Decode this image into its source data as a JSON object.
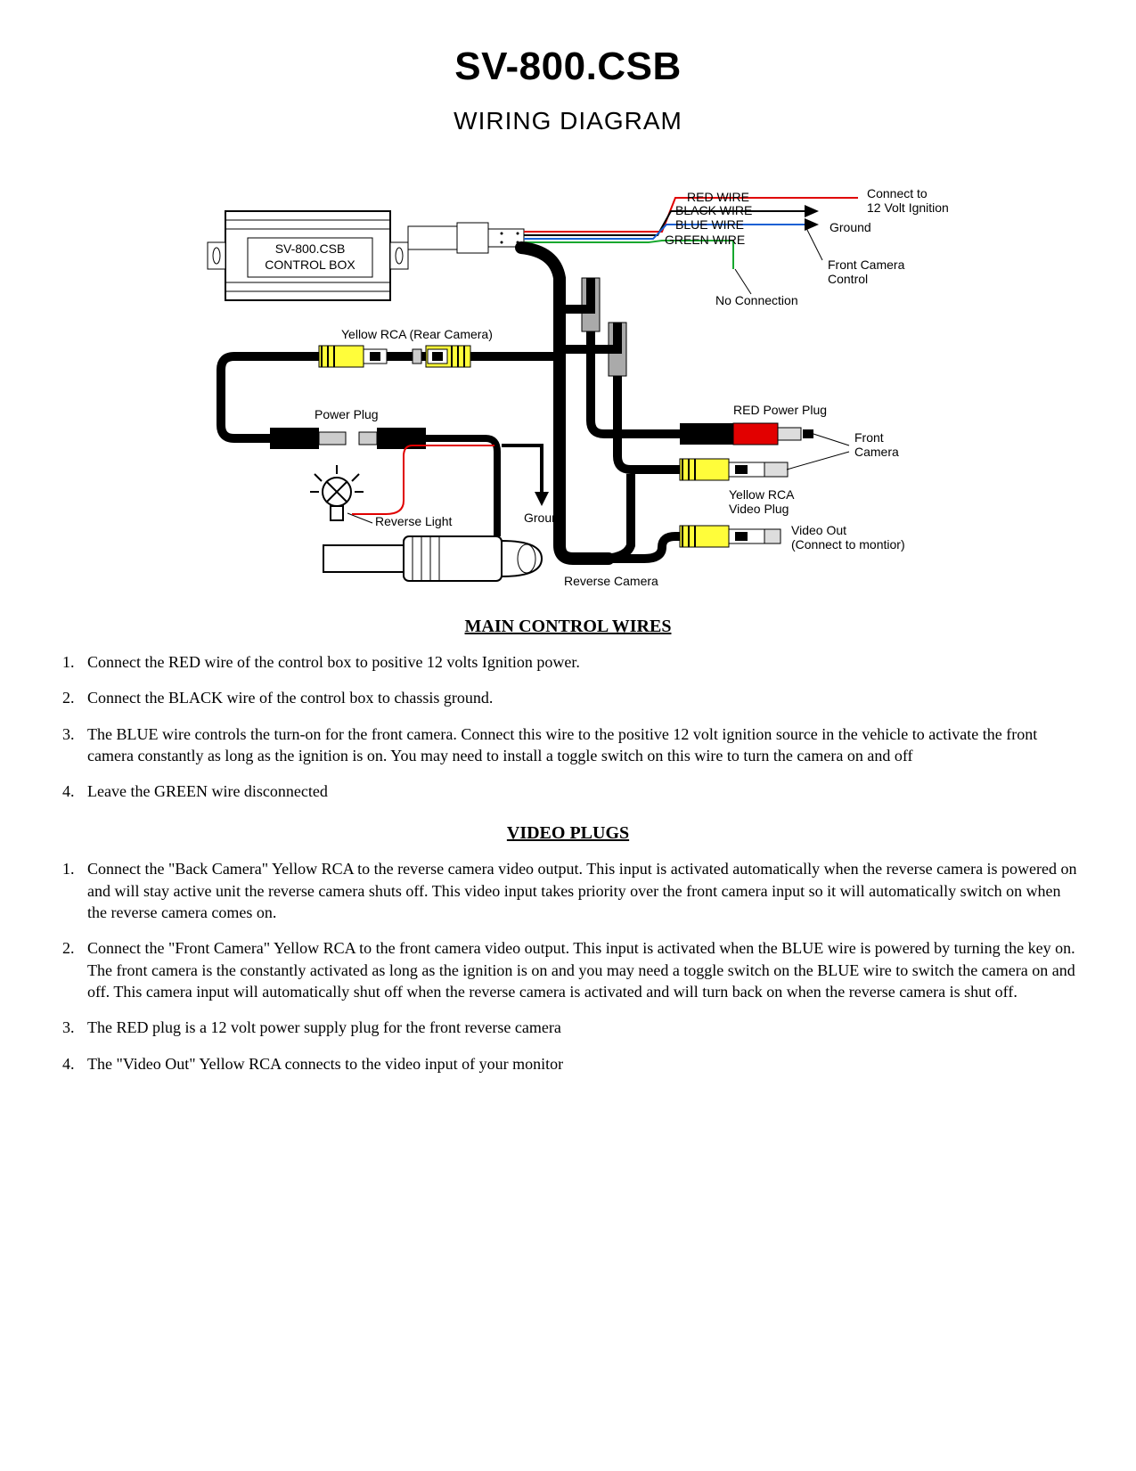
{
  "title": "SV-800.CSB",
  "subtitle": "WIRING DIAGRAM",
  "diagram": {
    "control_box_line1": "SV-800.CSB",
    "control_box_line2": "CONTROL BOX",
    "wire_red": "RED WIRE",
    "wire_black": "BLACK WIRE",
    "wire_blue": "BLUE WIRE",
    "wire_green": "GREEN WIRE",
    "red_dest_l1": "Connect to",
    "red_dest_l2": "12 Volt Ignition",
    "ground_label": "Ground",
    "front_cam_ctrl_l1": "Front Camera",
    "front_cam_ctrl_l2": "Control",
    "no_connection": "No Connection",
    "yellow_rca_rear": "Yellow RCA  (Rear Camera)",
    "power_plug": "Power Plug",
    "reverse_light": "Reverse Light",
    "ground2": "Ground",
    "red_power_plug": "RED Power Plug",
    "front_camera": "Front",
    "front_camera2": "Camera",
    "yellow_rca_video_l1": "Yellow RCA",
    "yellow_rca_video_l2": "Video Plug",
    "video_out_l1": "Video Out",
    "video_out_l2": "(Connect to montior)",
    "reverse_camera": "Reverse Camera"
  },
  "sections": {
    "main_wires_heading": "MAIN CONTROL WIRES",
    "main_wires": {
      "step1": "Connect the RED wire of the control box to positive 12 volts Ignition power.",
      "step2": "Connect the BLACK wire of the control box to chassis ground.",
      "step3": "The BLUE wire controls the turn-on for the front camera. Connect this wire to the positive 12 volt ignition source in the vehicle to activate the front camera constantly as long as the ignition is on. You may need to install a toggle switch on this wire to turn the camera on and off",
      "step4": "Leave the GREEN wire disconnected"
    },
    "video_plugs_heading": "VIDEO PLUGS",
    "video_plugs": {
      "step1": "Connect the \"Back Camera\" Yellow RCA to the reverse camera video output. This input is activated automatically when the reverse camera is powered on and will stay active unit the reverse camera shuts off. This video input takes priority over the front camera input so it will automatically switch on when the reverse camera comes on.",
      "step2": "Connect the \"Front Camera\" Yellow RCA to the front camera video output. This input is activated when the BLUE wire is powered by turning the key on. The front camera is the constantly activated as long as the ignition is on and you may need a toggle switch on the BLUE wire to switch the camera on and off. This camera input will automatically shut off when the reverse camera is activated and will turn back on when the reverse camera is shut off.",
      "step3": "The RED plug is a 12 volt power supply plug for the front reverse camera",
      "step4": "The \"Video Out\"  Yellow RCA connects to the video input of your monitor"
    }
  }
}
